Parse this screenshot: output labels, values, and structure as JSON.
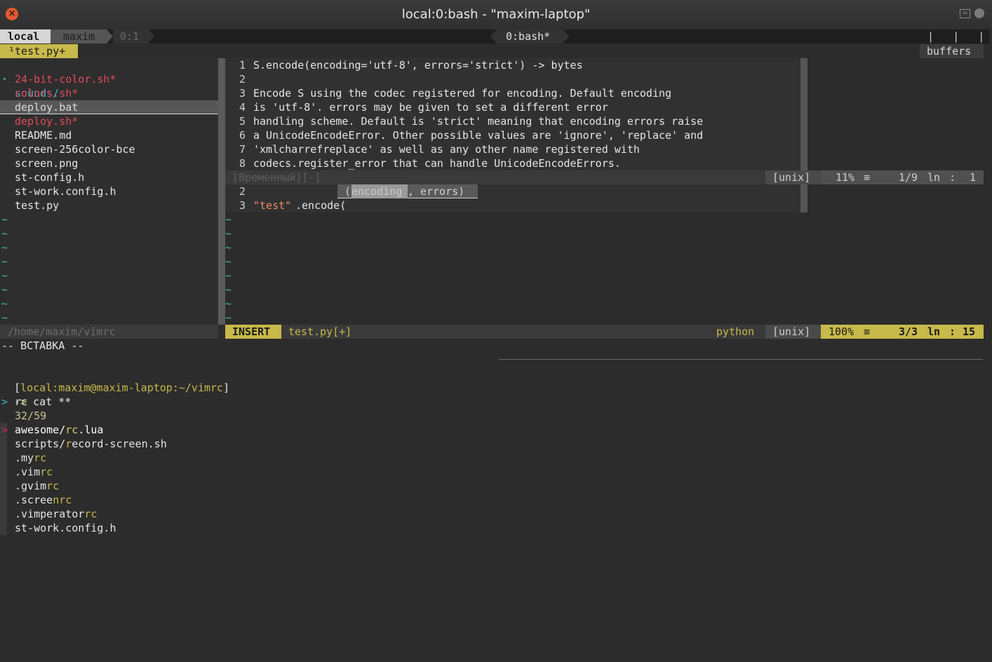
{
  "window": {
    "title": "local:0:bash - \"maxim-laptop\""
  },
  "tmux": {
    "session": "local",
    "user": "maxim",
    "pane": "0:1",
    "window_label": "0:bash*",
    "right_marks": "|   |   |"
  },
  "tabline": {
    "tab": "¹test.py+",
    "buffers_label": "buffers"
  },
  "tree": {
    "items": [
      {
        "marker": "▸",
        "name": "sounds/"
      },
      {
        "marker": "",
        "name": "24-bit-color.sh*"
      },
      {
        "marker": "",
        "name": "colors.sh*"
      },
      {
        "marker": "",
        "name": "deploy.bat"
      },
      {
        "marker": "",
        "name": "deploy.sh*"
      },
      {
        "marker": "",
        "name": "README.md"
      },
      {
        "marker": "",
        "name": "screen-256color-bce"
      },
      {
        "marker": "",
        "name": "screen.png"
      },
      {
        "marker": "",
        "name": "st-config.h"
      },
      {
        "marker": "",
        "name": "st-work.config.h"
      },
      {
        "marker": "",
        "name": "test.py"
      }
    ],
    "tilde": "~",
    "statusline": "/home/maxim/vimrc"
  },
  "doc": {
    "lines": [
      {
        "n": "1",
        "text": "S.encode(encoding='utf-8', errors='strict') -> bytes"
      },
      {
        "n": "2",
        "text": ""
      },
      {
        "n": "3",
        "text": "Encode S using the codec registered for encoding. Default encoding"
      },
      {
        "n": "4",
        "text": "is 'utf-8'. errors may be given to set a different error"
      },
      {
        "n": "5",
        "text": "handling scheme. Default is 'strict' meaning that encoding errors raise"
      },
      {
        "n": "6",
        "text": "a UnicodeEncodeError. Other possible values are 'ignore', 'replace' and"
      },
      {
        "n": "7",
        "text": "'xmlcharrefreplace' as well as any other name registered with"
      },
      {
        "n": "8",
        "text": "codecs.register_error that can handle UnicodeEncodeErrors."
      }
    ],
    "status": {
      "name": "[Временный][-]",
      "format": "[unix]",
      "percent": "11%",
      "sep": "≡",
      "position": "1/9",
      "ln": "ln",
      "colsep": ":",
      "col": "1"
    }
  },
  "editor": {
    "line2_n": "2",
    "signature": {
      "open": "(",
      "active_param": "encoding",
      "rest": ", errors)"
    },
    "line3_n": "3",
    "code_string": "\"test\"",
    "code_rest": ".encode(",
    "tilde": "~",
    "status": {
      "mode": "INSERT",
      "file": "test.py[+]",
      "filetype": "python",
      "format": "[unix]",
      "percent": "100%",
      "sep": "≡",
      "position": "3/3",
      "ln": "ln",
      "colsep": ":",
      "col": "15"
    }
  },
  "mode_msg": "-- ВСТАВКА --",
  "shell": {
    "prompt_open": "[",
    "prompt_host": "local:maxim@maxim-laptop:~/vimrc",
    "prompt_close": "]",
    "cmd_arrow": "->",
    "cmd": "cat **",
    "fzf_prompt": ">",
    "fzf_query": "rc",
    "fzf_count": "32/59",
    "fzf_pointer": ">",
    "results": [
      {
        "pre": "awesome/",
        "hl": "rc",
        "post": ".lua",
        "selected": true
      },
      {
        "pre": "scripts/",
        "hl": "r",
        "post": "ecord-screen.sh",
        "selected": false
      },
      {
        "pre": ".my",
        "hl": "rc",
        "post": "",
        "selected": false
      },
      {
        "pre": ".vim",
        "hl": "rc",
        "post": "",
        "selected": false
      },
      {
        "pre": ".gvim",
        "hl": "rc",
        "post": "",
        "selected": false
      },
      {
        "pre": ".scree",
        "hl": "nrc",
        "post": "",
        "selected": false
      },
      {
        "pre": ".vimperator",
        "hl": "rc",
        "post": "",
        "selected": false
      },
      {
        "pre": "st-work.config.h",
        "hl": "",
        "post": "",
        "selected": false
      }
    ]
  },
  "colors": {
    "accent_yellow": "#c8b94b",
    "tree_dir": "#3fb6c6",
    "tree_exec": "#e04a5a",
    "tilde": "#3fb6c6",
    "fzf_pointer": "#d0285c"
  }
}
